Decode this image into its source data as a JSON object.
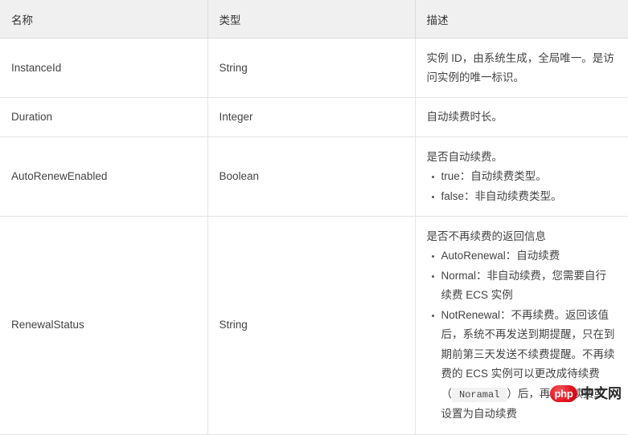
{
  "table": {
    "columns": [
      {
        "key": "name",
        "label": "名称"
      },
      {
        "key": "type",
        "label": "类型"
      },
      {
        "key": "desc",
        "label": "描述"
      }
    ],
    "rows": [
      {
        "name": "InstanceId",
        "type": "String",
        "desc_lead": "实例 ID，由系统生成，全局唯一。是访问实例的唯一标识。",
        "desc_items": []
      },
      {
        "name": "Duration",
        "type": "Integer",
        "desc_lead": "自动续费时长。",
        "desc_items": []
      },
      {
        "name": "AutoRenewEnabled",
        "type": "Boolean",
        "desc_lead": "是否自动续费。",
        "desc_items": [
          "true：自动续费类型。",
          "false：非自动续费类型。"
        ]
      },
      {
        "name": "RenewalStatus",
        "type": "String",
        "desc_lead": "是否不再续费的返回信息",
        "desc_items": [
          "AutoRenewal：自动续费",
          "Normal：非自动续费，您需要自行续费 ECS 实例"
        ],
        "desc_item_last": {
          "before": "NotRenewal：不再续费。返回该值后，系统不再发送到期提醒，只在到期前第三天发送不续费提醒。不再续费的 ECS 实例可以更改成待续费（",
          "code": "Noramal",
          "after": "）后，再自行续费或设置为自动续费"
        }
      }
    ]
  },
  "watermark": {
    "logo_text": "php",
    "site_text": "中文网",
    "logo_color": "#e8121b"
  }
}
